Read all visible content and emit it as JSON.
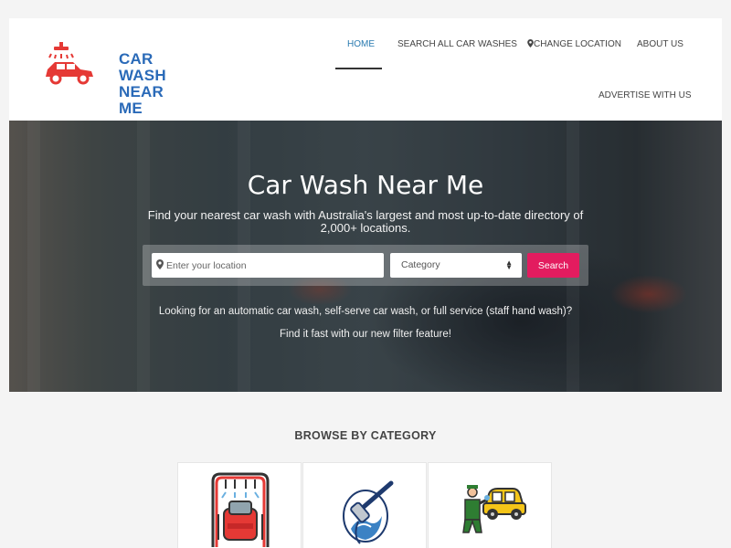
{
  "logo": {
    "line1": "CAR WASH",
    "line2": "NEAR ME"
  },
  "nav": {
    "home": "HOME",
    "search_all": "SEARCH ALL CAR WASHES",
    "change_location": "CHANGE LOCATION",
    "about": "ABOUT US",
    "advertise": "ADVERTISE WITH US"
  },
  "hero": {
    "title": "Car Wash Near Me",
    "subtitle": "Find your nearest car wash with Australia's largest and most up-to-date directory of 2,000+ locations.",
    "location_placeholder": "Enter your location",
    "category_selected": "Category",
    "search_label": "Search",
    "line1": "Looking for an automatic car wash, self-serve car wash, or full service (staff hand wash)?",
    "line2": "Find it fast with our new filter feature!"
  },
  "browse": {
    "title": "BROWSE BY CATEGORY",
    "categories": [
      {
        "icon": "automatic-car-wash-icon"
      },
      {
        "icon": "pressure-washer-icon"
      },
      {
        "icon": "hand-wash-icon"
      }
    ]
  },
  "colors": {
    "accent": "#e31c5f",
    "link_active": "#2a7ab0",
    "logo_blue": "#2a6ab8",
    "logo_red": "#e53935"
  }
}
